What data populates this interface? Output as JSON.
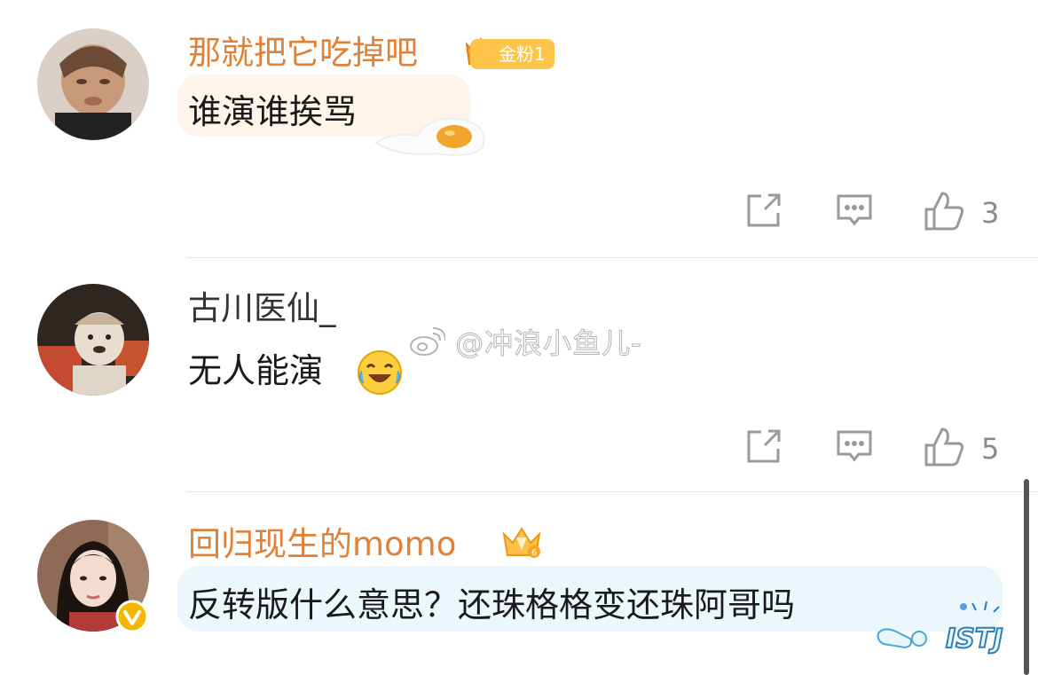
{
  "comments": [
    {
      "username": "那就把它吃掉吧",
      "fan_badge": "金粉1",
      "text": "谁演谁挨骂",
      "like_count": "3"
    },
    {
      "username": "古川医仙_",
      "text": "无人能演",
      "like_count": "5"
    },
    {
      "username": "回归现生的momo",
      "text": "反转版什么意思？还珠格格变还珠阿哥吗"
    }
  ],
  "watermark": "@冲浪小鱼儿-",
  "colors": {
    "gold_name": "#e0813a",
    "plain_name": "#333333",
    "icon": "#9a9a9a",
    "fan_badge": "#ffc44a",
    "verified": "#f5b800"
  }
}
